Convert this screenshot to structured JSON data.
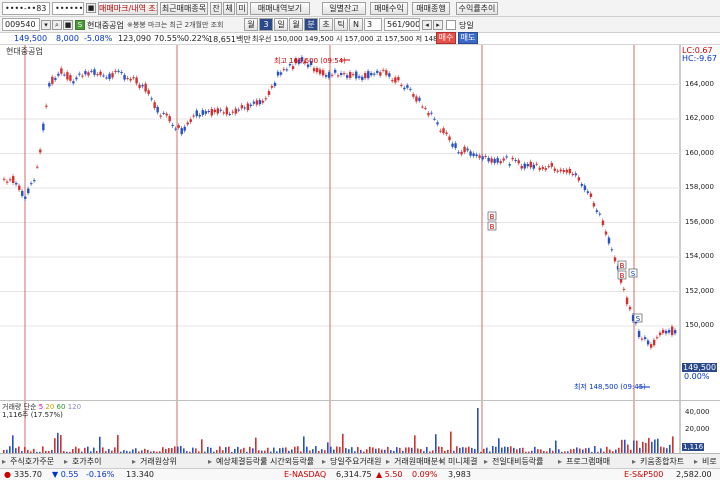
{
  "toolbar": {
    "account_value": "••••-••83",
    "password_value": "••••••••",
    "btn_tradelog": "매매마크/내역 조회",
    "btn_recent": "최근매매종목",
    "btn_jan": "잔",
    "btn_che": "체",
    "btn_mi": "미",
    "btn_history": "매매내역보기",
    "btn_daily": "일별잔고",
    "btn_profit": "매매수익",
    "btn_trend": "매매종행",
    "btn_rank": "수익률추이"
  },
  "controls": {
    "code": "009540",
    "stock_name": "현대중공업",
    "note": "※봉봉 마크는 최근 2개월만 조회",
    "period_label": "월",
    "period_value": "3",
    "btn_week": "일",
    "btn_month": "월",
    "btn_min": "분",
    "btn_tick": "초",
    "btn_t": "틱",
    "btn_n": "N",
    "count_value": "3",
    "range_value": "561/900",
    "today_label": "당일"
  },
  "quote": {
    "price": "149,500",
    "change": "8,000",
    "rate": "-5.08%",
    "volume": "123,090",
    "pct": "70.55%",
    "pct2": "0.22%",
    "amount": "18,651백만",
    "info": "최우선 150,000 149,500 시 157,000 고 157,500 저 148,500",
    "btn_buy": "매수",
    "btn_sell": "매도"
  },
  "chart": {
    "title": "현대중공업",
    "lc": "LC:0.67",
    "hc": "HC:-9.67",
    "high_label": "최고 165,500 (09:54)",
    "low_label": "최저 148,500 (09:45)",
    "current_price": "149,500",
    "current_pct": "0.00%",
    "marker_b": "B",
    "marker_s": "S"
  },
  "chart_data": {
    "type": "line",
    "title": "현대중공업",
    "ylim": [
      146000,
      166000
    ],
    "yticks": [
      "164,000",
      "162,000",
      "160,000",
      "158,000",
      "156,000",
      "154,000",
      "152,000",
      "150,000"
    ],
    "series": [
      {
        "values": [
          158500,
          157500,
          159000,
          164000,
          164800,
          164200,
          164800,
          164600,
          164500,
          164600,
          164300,
          163800,
          162500,
          162000,
          161300,
          162300,
          162500,
          162400,
          162500,
          162600,
          162800,
          163000,
          164500,
          165000,
          165500,
          165000,
          164500,
          164700,
          164600,
          164500,
          164700,
          164600,
          164200,
          163600,
          162800,
          162000,
          161000,
          160200,
          160100,
          159800,
          159700,
          159600,
          159400,
          159300,
          159300,
          159200,
          159100,
          158500,
          157500,
          156000,
          154000,
          151500,
          149500,
          148800,
          149800,
          149700
        ]
      }
    ]
  },
  "volume": {
    "title": "거래량",
    "ma5": "5",
    "ma20": "20",
    "ma60": "60",
    "ma120": "120",
    "ma_label": "단순",
    "value_label": "1,116주 (17.57%)",
    "yticks": [
      "40,000",
      "20,000"
    ],
    "last": "1,116"
  },
  "tabs": [
    "주식호가주문",
    "호가추이",
    "거래원상위",
    "예상체결등락률",
    "시간외등락률",
    "당일주요거래원",
    "거래원매매분석",
    "미니체결",
    "전일대비등락률",
    "프로그램매매",
    "키움종합차트",
    "비로"
  ],
  "ticker": {
    "v1": "335.70",
    "c1": "▼ 0.55",
    "r1": "-0.16%",
    "v2": "13.340",
    "n3": "E-NASDAQ",
    "v3": "6,314.75",
    "c3": "▲ 5.50",
    "r3": "0.09%",
    "v4": "3,983",
    "n5": "E-S&P500",
    "v5": "2,582.00"
  }
}
